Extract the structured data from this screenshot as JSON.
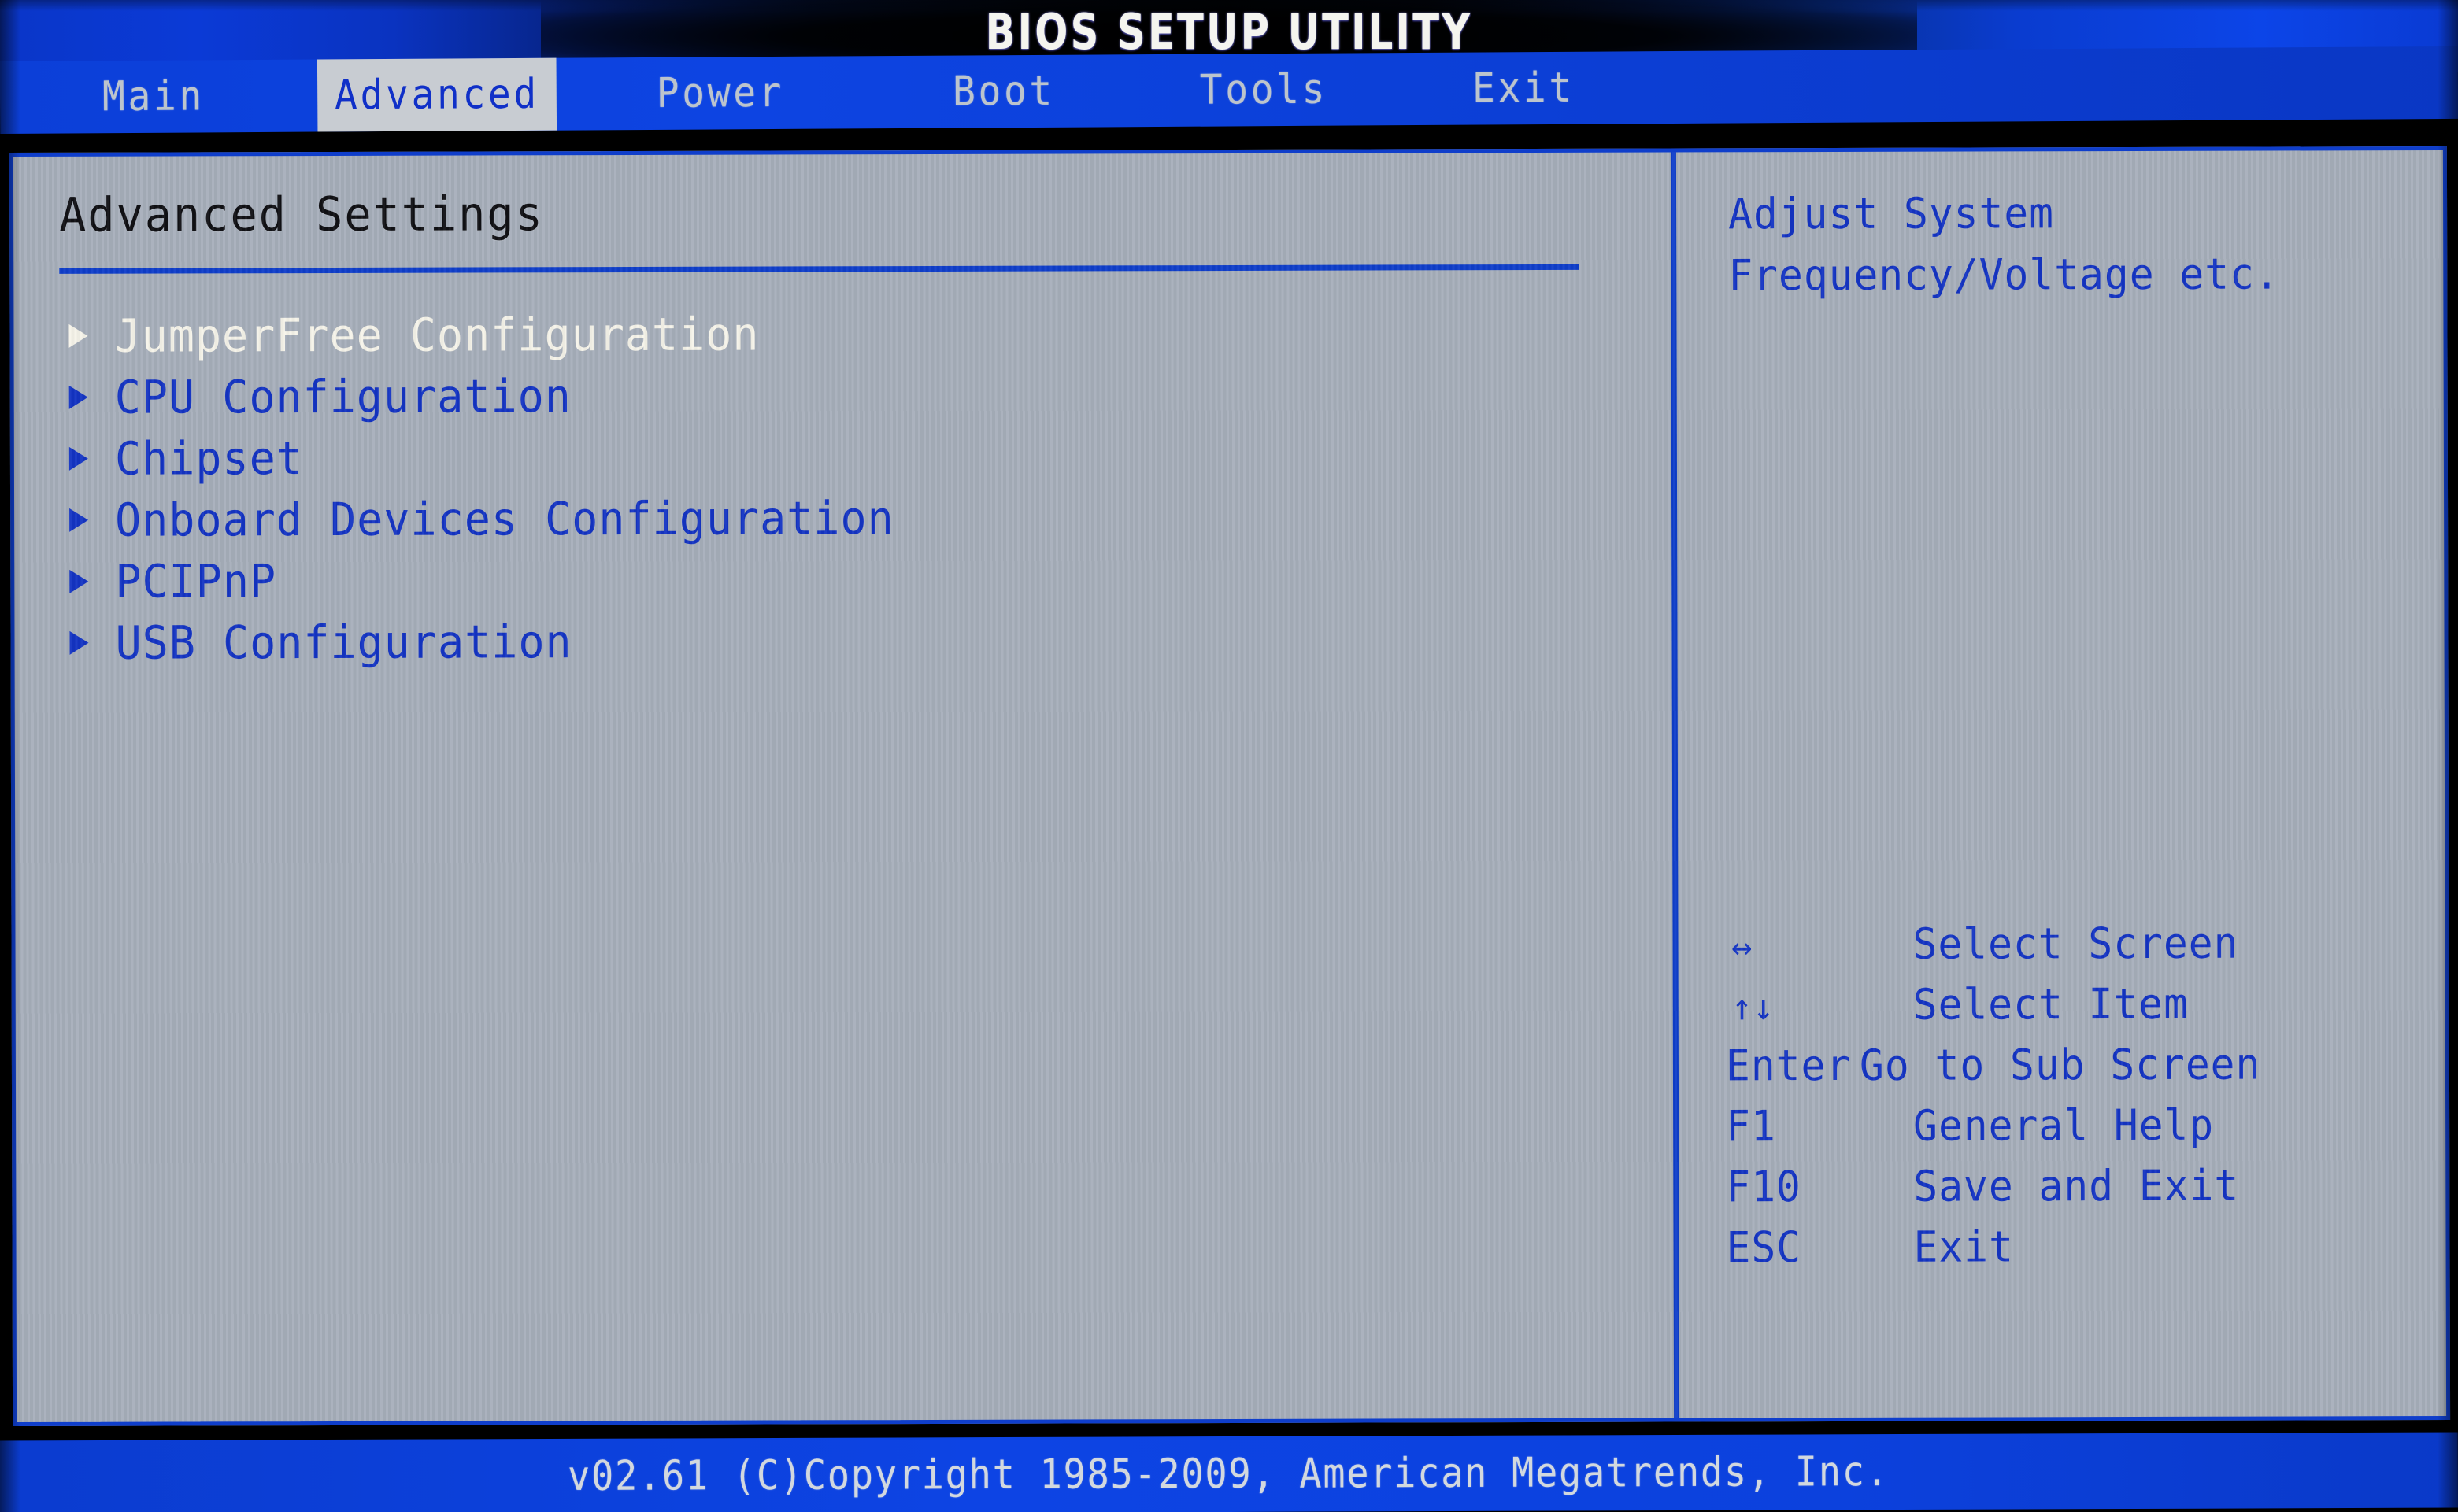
{
  "titlebar": {
    "title": "BIOS SETUP UTILITY"
  },
  "menubar": {
    "tabs": [
      {
        "label": "Main",
        "active": false
      },
      {
        "label": "Advanced",
        "active": true
      },
      {
        "label": "Power",
        "active": false
      },
      {
        "label": "Boot",
        "active": false
      },
      {
        "label": "Tools",
        "active": false
      },
      {
        "label": "Exit",
        "active": false
      }
    ]
  },
  "main": {
    "section_title": "Advanced Settings",
    "items": [
      {
        "label": "JumperFree Configuration",
        "selected": true
      },
      {
        "label": "CPU Configuration",
        "selected": false
      },
      {
        "label": "Chipset",
        "selected": false
      },
      {
        "label": "Onboard Devices Configuration",
        "selected": false
      },
      {
        "label": "PCIPnP",
        "selected": false
      },
      {
        "label": "USB Configuration",
        "selected": false
      }
    ]
  },
  "help": {
    "lines": [
      "Adjust System",
      "Frequency/Voltage etc."
    ]
  },
  "keys": [
    {
      "key": "↔",
      "desc": "Select Screen",
      "symbol": true
    },
    {
      "key": "↑↓",
      "desc": "Select Item",
      "symbol": true
    },
    {
      "key": "Enter",
      "desc": "Go to Sub Screen",
      "symbol": false
    },
    {
      "key": "F1",
      "desc": "General Help",
      "symbol": false
    },
    {
      "key": "F10",
      "desc": "Save and Exit",
      "symbol": false
    },
    {
      "key": "ESC",
      "desc": "Exit",
      "symbol": false
    }
  ],
  "footer": {
    "text": "v02.61 (C)Copyright 1985-2009, American Megatrends, Inc."
  },
  "colors": {
    "accent_blue": "#1434c4",
    "bar_blue": "#0d44e2",
    "panel_bg": "#a7afbb",
    "selected_text": "#f6f4ea",
    "heading_text": "#101014"
  }
}
